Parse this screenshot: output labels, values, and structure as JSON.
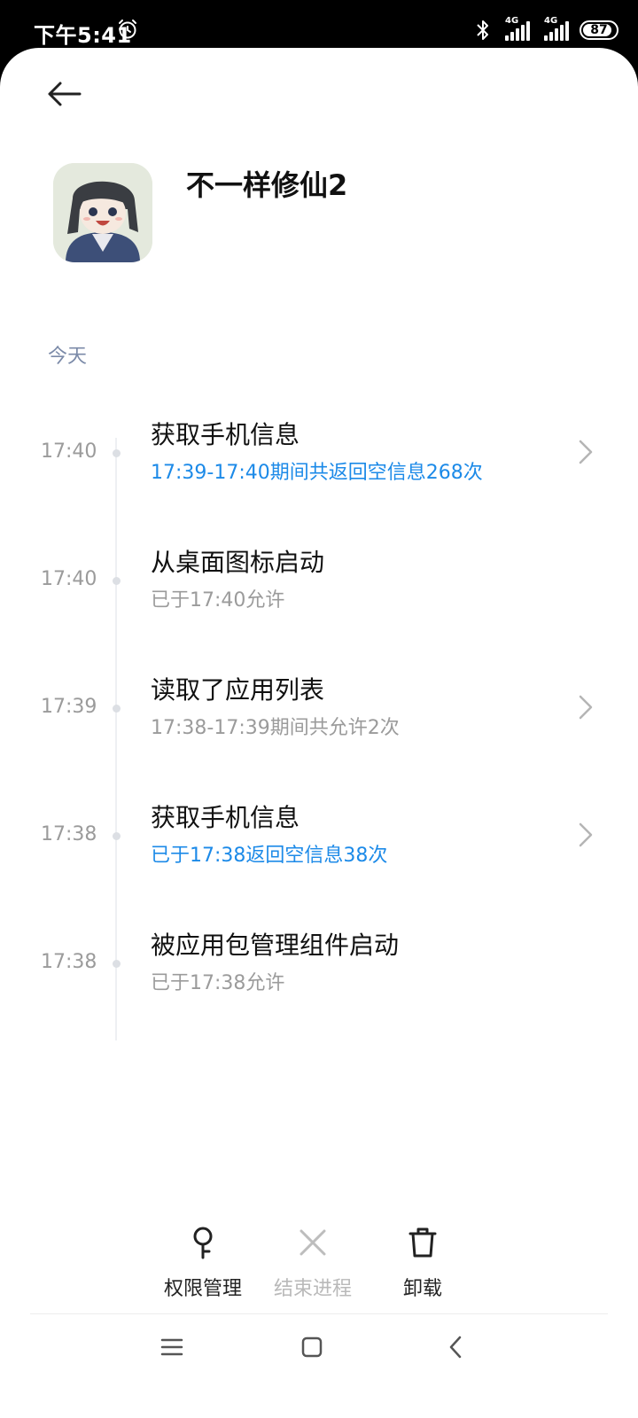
{
  "status_bar": {
    "time": "下午5:41",
    "network_1": "4G",
    "network_2": "4G",
    "battery": "87"
  },
  "app": {
    "name": "不一样修仙2",
    "icon": "app-avatar-icon"
  },
  "section_label": "今天",
  "events": [
    {
      "time": "17:40",
      "title": "获取手机信息",
      "subtitle": "17:39-17:40期间共返回空信息268次",
      "highlight": true,
      "has_arrow": true
    },
    {
      "time": "17:40",
      "title": "从桌面图标启动",
      "subtitle": "已于17:40允许",
      "highlight": false,
      "has_arrow": false
    },
    {
      "time": "17:39",
      "title": "读取了应用列表",
      "subtitle": "17:38-17:39期间共允许2次",
      "highlight": false,
      "has_arrow": true
    },
    {
      "time": "17:38",
      "title": "获取手机信息",
      "subtitle": "已于17:38返回空信息38次",
      "highlight": true,
      "has_arrow": true
    },
    {
      "time": "17:38",
      "title": "被应用包管理组件启动",
      "subtitle": "已于17:38允许",
      "highlight": false,
      "has_arrow": false
    }
  ],
  "actions": {
    "permissions": "权限管理",
    "end_process": "结束进程",
    "uninstall": "卸载"
  },
  "colors": {
    "accent_blue": "#1c8ae8",
    "muted_gray": "#9b9b9b",
    "section_label": "#7b8aa8"
  }
}
